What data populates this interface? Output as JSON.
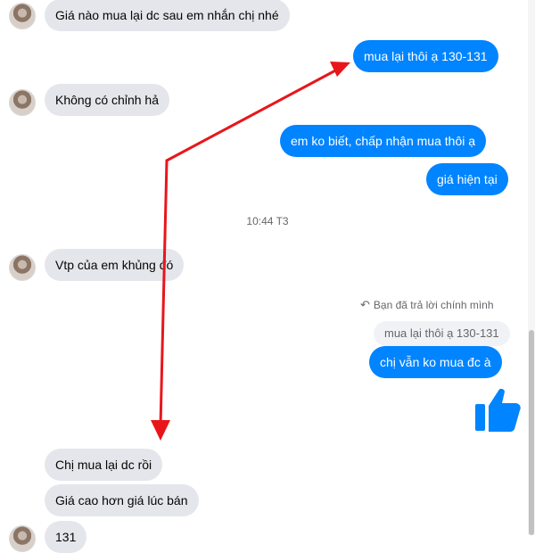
{
  "messages": {
    "m1": "Giá nào mua lại dc sau em nhắn chị nhé",
    "m2": "mua lại thôi ạ 130-131",
    "m3": "Không có chỉnh hả",
    "m4": "em ko biết, chấp nhận mua thôi ạ",
    "m5": "giá hiện tại",
    "m6": "Vtp của em khủng đó",
    "m7": "chị vẫn ko mua đc à",
    "m8": "Chị mua lại dc rồi",
    "m9": "Giá cao hơn giá lúc bán",
    "m10": "131"
  },
  "timestamp": "10:44 T3",
  "reply_note": "Bạn đã trả lời chính mình",
  "quoted_message": "mua lại thôi ạ 130-131",
  "colors": {
    "outgoing": "#0084ff",
    "incoming": "#e4e6eb",
    "annotation_arrow": "#e8161b"
  },
  "icons": {
    "like": "thumbs-up-icon",
    "reply": "reply-arrow-icon"
  }
}
